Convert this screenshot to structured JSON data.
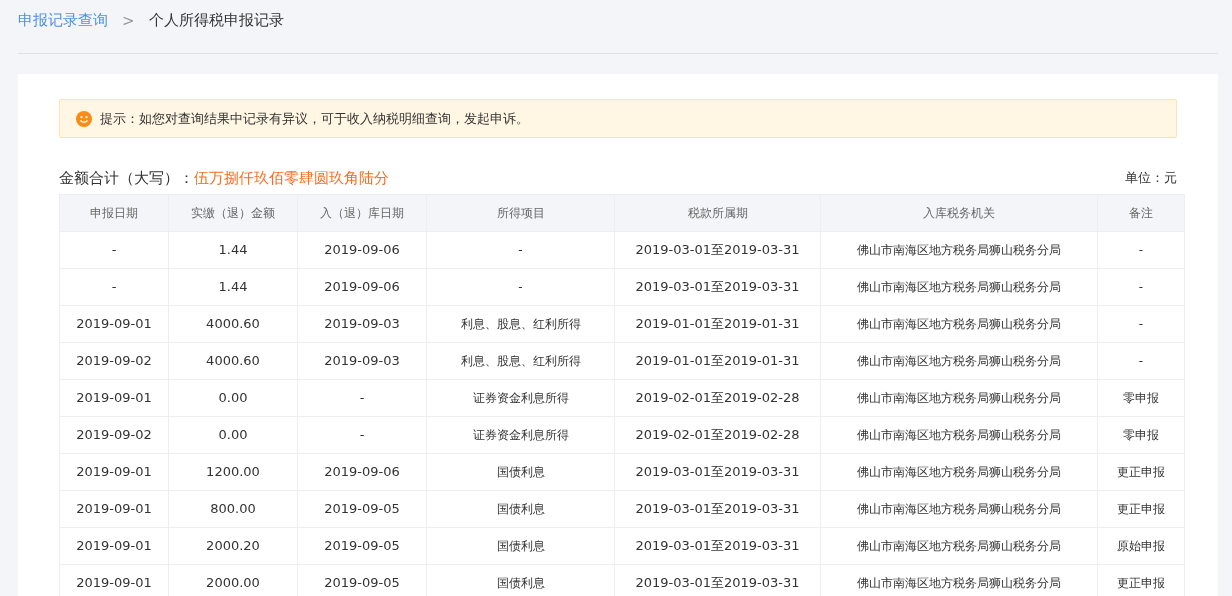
{
  "breadcrumb": {
    "parent": "申报记录查询",
    "separator": ">",
    "current": "个人所得税申报记录"
  },
  "notice": {
    "text": "提示：如您对查询结果中记录有异议，可于收入纳税明细查询，发起申诉。"
  },
  "summary": {
    "label": "金额合计（大写）：",
    "amount": "伍万捌仟玖佰零肆圆玖角陆分",
    "unit": "单位：元"
  },
  "table": {
    "columns": [
      "申报日期",
      "实缴（退）金额",
      "入（退）库日期",
      "所得项目",
      "税款所属期",
      "入库税务机关",
      "备注"
    ],
    "rows": [
      [
        "-",
        "1.44",
        "2019-09-06",
        "-",
        "2019-03-01至2019-03-31",
        "佛山市南海区地方税务局狮山税务分局",
        "-"
      ],
      [
        "-",
        "1.44",
        "2019-09-06",
        "-",
        "2019-03-01至2019-03-31",
        "佛山市南海区地方税务局狮山税务分局",
        "-"
      ],
      [
        "2019-09-01",
        "4000.60",
        "2019-09-03",
        "利息、股息、红利所得",
        "2019-01-01至2019-01-31",
        "佛山市南海区地方税务局狮山税务分局",
        "-"
      ],
      [
        "2019-09-02",
        "4000.60",
        "2019-09-03",
        "利息、股息、红利所得",
        "2019-01-01至2019-01-31",
        "佛山市南海区地方税务局狮山税务分局",
        "-"
      ],
      [
        "2019-09-01",
        "0.00",
        "-",
        "证券资金利息所得",
        "2019-02-01至2019-02-28",
        "佛山市南海区地方税务局狮山税务分局",
        "零申报"
      ],
      [
        "2019-09-02",
        "0.00",
        "-",
        "证券资金利息所得",
        "2019-02-01至2019-02-28",
        "佛山市南海区地方税务局狮山税务分局",
        "零申报"
      ],
      [
        "2019-09-01",
        "1200.00",
        "2019-09-06",
        "国债利息",
        "2019-03-01至2019-03-31",
        "佛山市南海区地方税务局狮山税务分局",
        "更正申报"
      ],
      [
        "2019-09-01",
        "800.00",
        "2019-09-05",
        "国债利息",
        "2019-03-01至2019-03-31",
        "佛山市南海区地方税务局狮山税务分局",
        "更正申报"
      ],
      [
        "2019-09-01",
        "2000.20",
        "2019-09-05",
        "国债利息",
        "2019-03-01至2019-03-31",
        "佛山市南海区地方税务局狮山税务分局",
        "原始申报"
      ],
      [
        "2019-09-01",
        "2000.00",
        "2019-09-05",
        "国债利息",
        "2019-03-01至2019-03-31",
        "佛山市南海区地方税务局狮山税务分局",
        "更正申报"
      ]
    ]
  }
}
